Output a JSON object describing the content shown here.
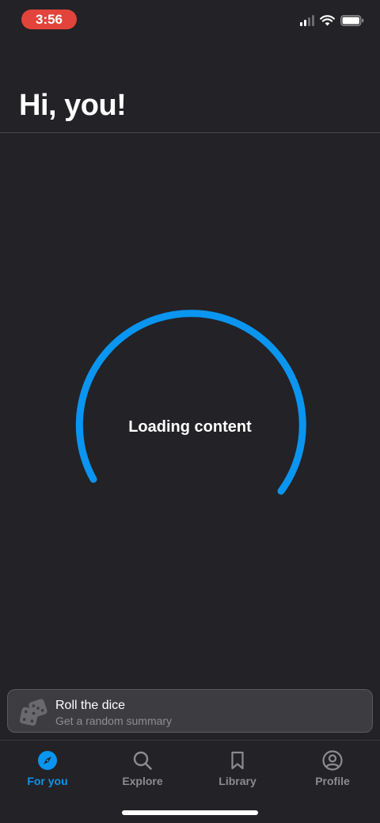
{
  "status_bar": {
    "time": "3:56",
    "signal_icon": "cellular-signal-icon",
    "wifi_icon": "wifi-icon",
    "battery_icon": "battery-icon"
  },
  "header": {
    "title": "Hi, you!"
  },
  "loader": {
    "text": "Loading content",
    "accent_color": "#0a95f0"
  },
  "dice_card": {
    "icon": "dice-icon",
    "title": "Roll the dice",
    "subtitle": "Get a random summary"
  },
  "tab_bar": {
    "tabs": [
      {
        "label": "For you",
        "icon": "compass-icon",
        "active": true
      },
      {
        "label": "Explore",
        "icon": "search-icon",
        "active": false
      },
      {
        "label": "Library",
        "icon": "bookmark-icon",
        "active": false
      },
      {
        "label": "Profile",
        "icon": "profile-icon",
        "active": false
      }
    ]
  },
  "colors": {
    "background": "#232226",
    "accent": "#0a95f0",
    "time_pill": "#e2443b",
    "inactive_tab": "#8c8b90"
  }
}
